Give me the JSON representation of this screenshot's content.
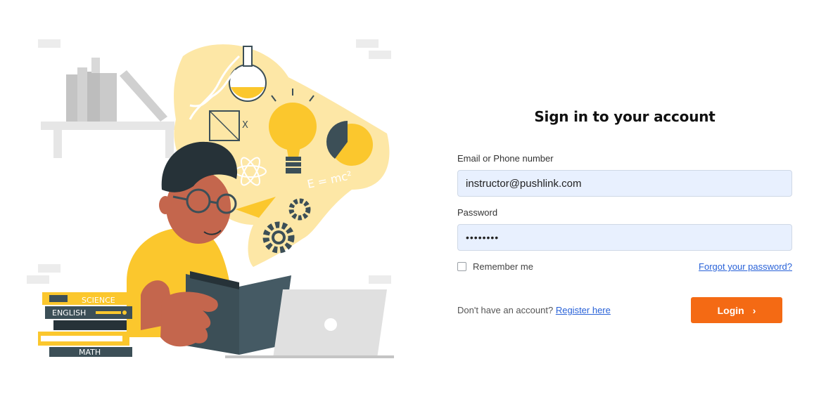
{
  "illustration": {
    "book_labels": [
      "SCIENCE",
      "ENGLISH",
      "MATH"
    ],
    "formula": "E = mc²",
    "chalkboard_mark": "X"
  },
  "form": {
    "title": "Sign in to your account",
    "email_label": "Email or Phone number",
    "email_value": "instructor@pushlink.com",
    "password_label": "Password",
    "password_value": "••••••••",
    "remember_label": "Remember me",
    "forgot_link": "Forgot your password?",
    "register_prompt": "Don't have an account?",
    "register_link": "Register here",
    "login_label": "Login",
    "login_chevron": "›"
  },
  "colors": {
    "accent": "#f46a14",
    "link": "#2962d8",
    "input_bg": "#e8f0fe",
    "illustration_yellow": "#fbc72d",
    "illustration_dark": "#3c4f57"
  }
}
